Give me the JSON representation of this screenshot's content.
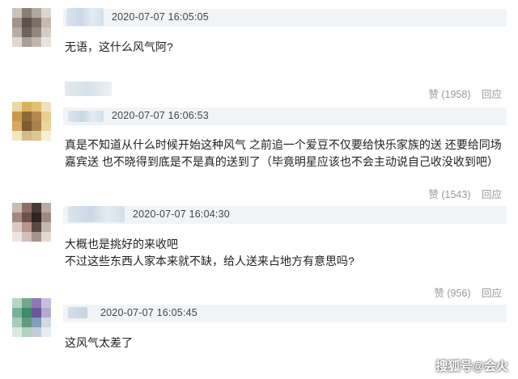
{
  "comments": [
    {
      "time": "2020-07-07 16:05:05",
      "text": "无语，这什么风气阿?",
      "like_label": "赞",
      "like_count": "(1958)",
      "reply_label": "回应"
    },
    {
      "time": "2020-07-07 16:06:53",
      "text": "真是不知道从什么时候开始这种风气 之前追一个爱豆不仅要给快乐家族的送 还要给同场嘉宾送 也不晓得到底是不是真的送到了（毕竟明星应该也不会主动说自己收没收到吧）",
      "like_label": "赞",
      "like_count": "(1543)",
      "reply_label": "回应"
    },
    {
      "time": "2020-07-07 16:04:30",
      "text_line1": "大概也是挑好的来收吧",
      "text_line2": "不过这些东西人家本来就不缺，给人送来占地方有意思吗?",
      "like_label": "赞",
      "like_count": "(956)",
      "reply_label": "回应"
    },
    {
      "time": "2020-07-07 16:05:45",
      "text": "这风气太差了"
    }
  ],
  "watermark": "搜狐号@会火",
  "colors": {
    "header_bar": "#f1f4f7",
    "action_text": "#999999",
    "body_text": "#222222"
  }
}
